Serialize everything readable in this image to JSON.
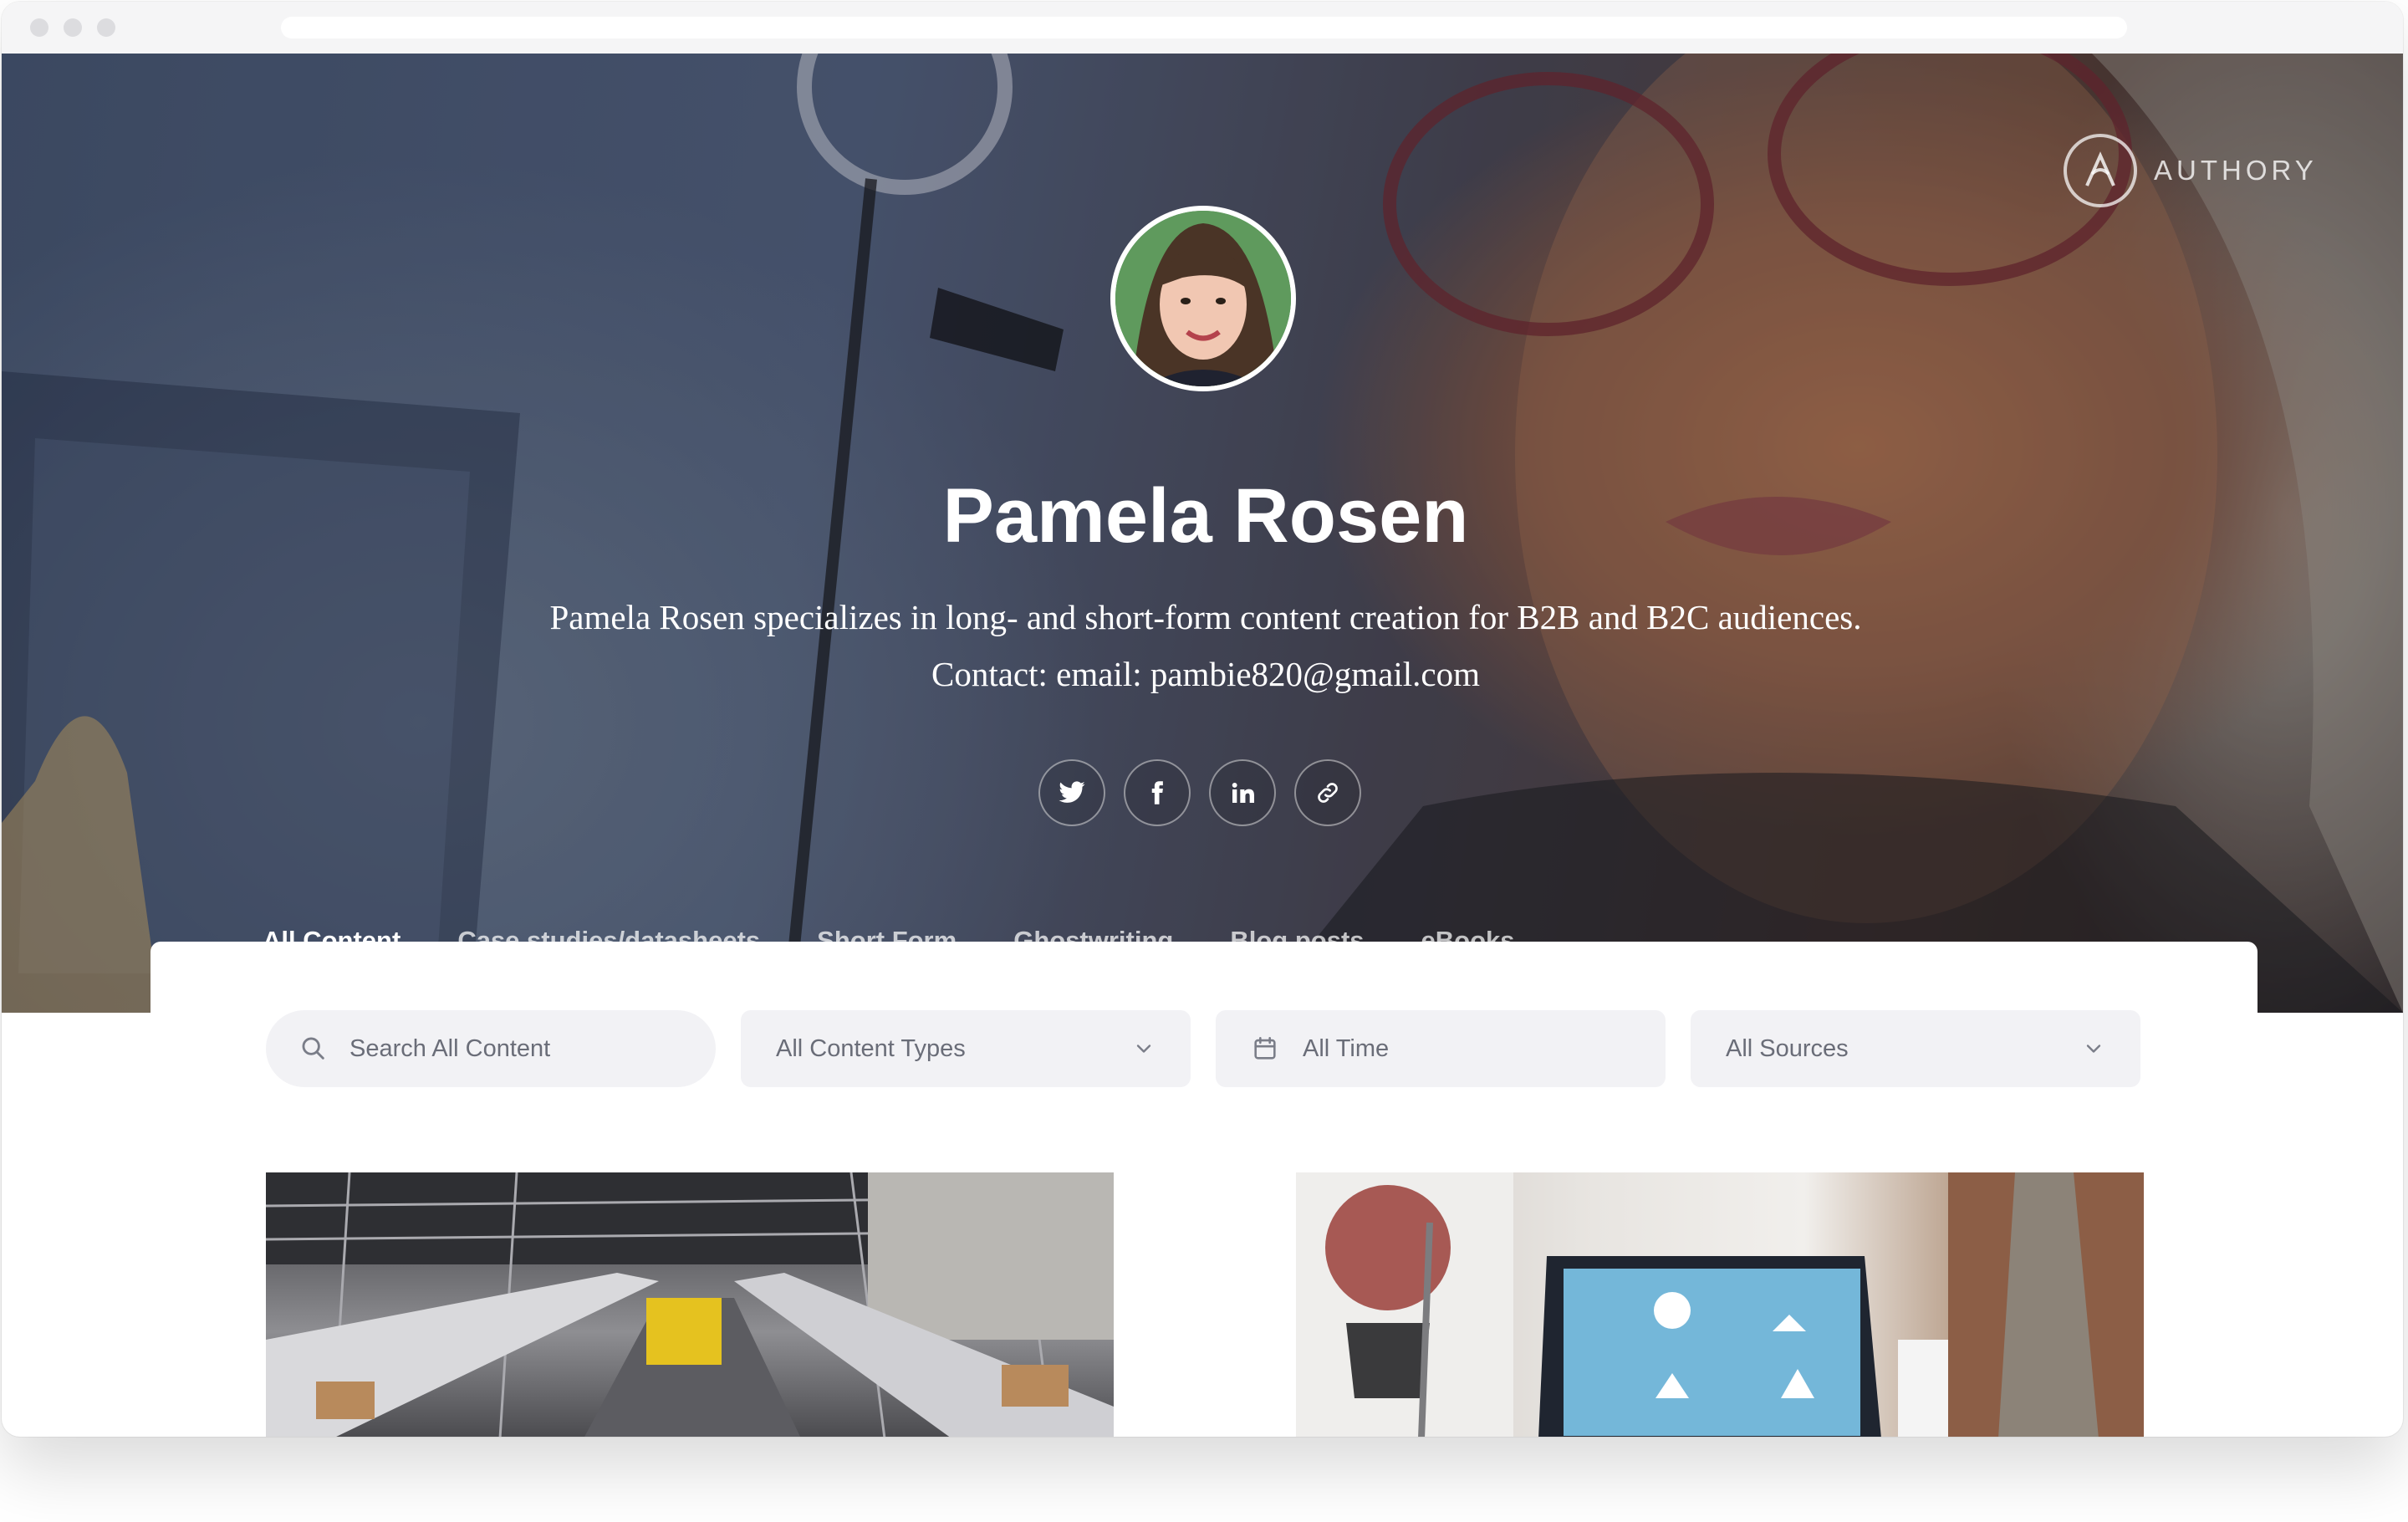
{
  "browser": {
    "window_controls": [
      "close",
      "minimize",
      "maximize"
    ]
  },
  "brand": {
    "name": "AUTHORY",
    "icon": "authory-logo-icon"
  },
  "profile": {
    "name": "Pamela Rosen",
    "bio": "Pamela Rosen specializes in long- and short-form content creation for B2B and B2C audiences. Contact: email: pambie820@gmail.com",
    "avatar_icon": "avatar-illustration"
  },
  "socials": [
    {
      "icon": "twitter-icon"
    },
    {
      "icon": "facebook-icon"
    },
    {
      "icon": "linkedin-icon"
    },
    {
      "icon": "link-icon"
    }
  ],
  "tabs": [
    {
      "label": "All Content",
      "active": true
    },
    {
      "label": "Case studies/datasheets",
      "active": false
    },
    {
      "label": "Short Form",
      "active": false
    },
    {
      "label": "Ghostwriting",
      "active": false
    },
    {
      "label": "Blog posts",
      "active": false
    },
    {
      "label": "eBooks",
      "active": false
    }
  ],
  "filters": {
    "search_placeholder": "Search All Content",
    "content_types": "All Content Types",
    "time": "All Time",
    "sources": "All Sources"
  },
  "colors": {
    "accent": "#3f6bf0",
    "field_bg": "#f2f2f5",
    "field_text": "#6a6d78"
  },
  "cards": [
    {
      "image": "warehouse-conveyor-photo"
    },
    {
      "image": "laptop-dashboard-photo"
    }
  ]
}
